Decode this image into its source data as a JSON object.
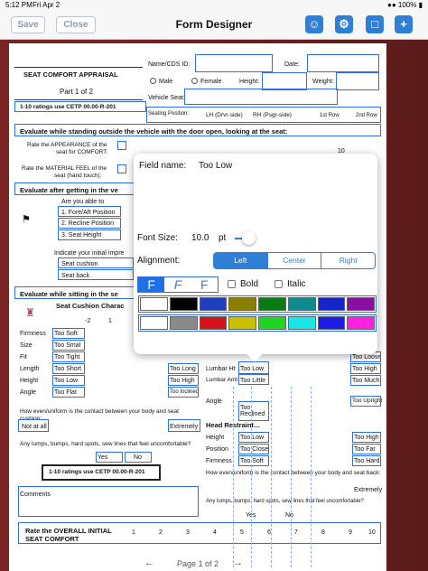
{
  "status": {
    "time": "5:12 PM",
    "date": "Fri Apr 2",
    "battery": "100%"
  },
  "nav": {
    "save": "Save",
    "close": "Close",
    "title": "Form Designer"
  },
  "form": {
    "title": "SEAT COMFORT APPRAISAL",
    "part": "Part 1 of 2",
    "ratings": "1-10 ratings use CETP 00.00-R-201",
    "name_lbl": "Name/CDS ID:",
    "date_lbl": "Date:",
    "male": "Male",
    "female": "Female",
    "height": "Height:",
    "weight": "Weight:",
    "vseat": "Vehicle Seat:",
    "seatpos": "Seating Position:",
    "pos": [
      "LH (Drvr-side)",
      "RH (Psgr-side)",
      "1st Row",
      "2nd Row"
    ],
    "sec1": "Evaluate while standing outside the vehicle with the door open, looking at the seat:",
    "appear": [
      "Rate the APPEARANCE of the",
      "seat for COMFORT:"
    ],
    "material": [
      "Rate the MATERIAL FEEL of the",
      "seat (hand touch):"
    ],
    "nums": [
      "1",
      "2",
      "3",
      "4",
      "5",
      "6",
      "7",
      "8",
      "9",
      "10"
    ],
    "sec2": "Evaluate after getting in the ve",
    "adjust": "Are you able to",
    "adj_items": [
      "1.  Fore/Aft Position",
      "2.  Recline Position",
      "3.  Seat Height"
    ],
    "indicate": "Indicate your initial impre",
    "ind_items": [
      "Seat cushion",
      "Seat back"
    ],
    "sec3": "Evaluate while sitting in the se",
    "cushion": "Seat Cushion Charac",
    "scale": [
      "-2",
      "1"
    ],
    "rows": [
      "Firmness",
      "Size",
      "Fit",
      "Length",
      "Height",
      "Angle"
    ],
    "cushL": [
      "Too Soft",
      "Too Smal",
      "Too Tight",
      "Too Short",
      "Too Low",
      "Too Flat"
    ],
    "cushR": [
      "Too Long",
      "Too High",
      "Too Inclined"
    ],
    "mid": [
      "Lumbar Ht",
      "Lumbar Amt",
      "Angle"
    ],
    "midv": [
      "Too Low",
      "Too Little",
      "Too Reclined"
    ],
    "right": [
      "Too Loose",
      "Too High",
      "Too Much",
      "Too Upright"
    ],
    "q1": "How even/uniform is the contact between your body and seat cushion:",
    "notall": "Not at all",
    "extremely": "Extremely",
    "q2": "Any lumps, bumps, hard spots, sew lines that feel uncomfortable?",
    "yes": "Yes",
    "no": "No",
    "ratings2": "1-10 ratings use CETP 00.00-R-201",
    "comments": "Comments",
    "head": "Head Restraint…",
    "hr_rows": [
      "Height",
      "Position",
      "Firmness"
    ],
    "hr_l": [
      "Too Low",
      "Too Close",
      "Too Soft"
    ],
    "hr_r": [
      "Too High",
      "Too Far",
      "Too Hard"
    ],
    "q3": "How even/uniform is the contact between your body and seat back:",
    "q4": "Any lumps, bumps, hard spots, sew lines that feel uncomfortable?",
    "overall": [
      "Rate the OVERALL INITIAL",
      "SEAT COMFORT"
    ],
    "pager": "Page 1 of 2"
  },
  "popup": {
    "field_name_lbl": "Field name:",
    "field_name": "Too Low",
    "font_size_lbl": "Font Size:",
    "font_size": "10.0",
    "unit": "pt",
    "align_lbl": "Alignment:",
    "align": [
      "Left",
      "Center",
      "Right"
    ],
    "bold": "Bold",
    "italic": "Italic",
    "colors_top": [
      "#ffffff",
      "#000000",
      "#1f3fbf",
      "#8a7f00",
      "#0a7a17",
      "#0f8b8d",
      "#1426c8",
      "#8a0ea0"
    ],
    "colors_bottom": [
      "#ffffff",
      "#8a8a8a",
      "#d3141b",
      "#c9c100",
      "#1fd51f",
      "#19e6e6",
      "#1d1de6",
      "#ff20e0"
    ]
  }
}
